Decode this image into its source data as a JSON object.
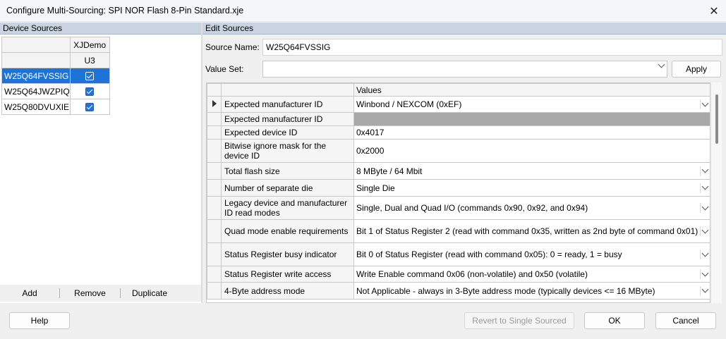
{
  "window": {
    "title": "Configure Multi-Sourcing: SPI NOR Flash 8-Pin Standard.xje",
    "close_glyph": "✕"
  },
  "left": {
    "header": "Device Sources",
    "grid": {
      "col_header": "XJDemo",
      "col_sub": "U3",
      "rows": [
        {
          "label": "W25Q64FVSSIG",
          "checked": true,
          "selected": true
        },
        {
          "label": "W25Q64JWZPIQ",
          "checked": true,
          "selected": false
        },
        {
          "label": "W25Q80DVUXIE",
          "checked": true,
          "selected": false
        }
      ]
    },
    "buttons": {
      "add": "Add",
      "remove": "Remove",
      "duplicate": "Duplicate"
    }
  },
  "right": {
    "header": "Edit Sources",
    "source_name_label": "Source Name:",
    "source_name_value": "W25Q64FVSSIG",
    "value_set_label": "Value Set:",
    "value_set_value": "",
    "apply_label": "Apply",
    "grid": {
      "values_header": "Values",
      "rows": [
        {
          "name": "Expected manufacturer ID",
          "value": "Winbond / NEXCOM (0xEF)",
          "dropdown": true,
          "current": true
        },
        {
          "name": "Expected manufacturer ID",
          "value": "",
          "disabled": true
        },
        {
          "name": "Expected device ID",
          "value": "0x4017"
        },
        {
          "name": "Bitwise ignore mask for the device ID",
          "value": "0x2000"
        },
        {
          "name": "Total flash size",
          "value": "8 MByte / 64 Mbit",
          "dropdown": true
        },
        {
          "name": "Number of separate die",
          "value": "Single Die",
          "dropdown": true
        },
        {
          "name": "Legacy device and manufacturer ID read modes",
          "value": "Single, Dual and Quad I/O (commands 0x90, 0x92, and 0x94)",
          "dropdown": true
        },
        {
          "name": "Quad mode enable requirements",
          "value": "Bit 1 of Status Register 2 (read with command 0x35, written as 2nd byte of command 0x01)",
          "dropdown": true
        },
        {
          "name": "Status Register busy indicator",
          "value": "Bit 0 of Status Register (read with command 0x05): 0 = ready, 1 = busy",
          "dropdown": true
        },
        {
          "name": "Status Register write access",
          "value": "Write Enable command 0x06 (non-volatile) and 0x50 (volatile)",
          "dropdown": true
        },
        {
          "name": "4-Byte address mode",
          "value": "Not Applicable - always in 3-Byte address mode (typically devices <= 16 MByte)",
          "dropdown": true
        }
      ]
    }
  },
  "footer": {
    "help": "Help",
    "revert": "Revert to Single Sourced",
    "ok": "OK",
    "cancel": "Cancel"
  },
  "colors": {
    "selection": "#1e73d6",
    "panel_header": "#c9d3e1",
    "disabled_cell": "#a9a9a9"
  }
}
